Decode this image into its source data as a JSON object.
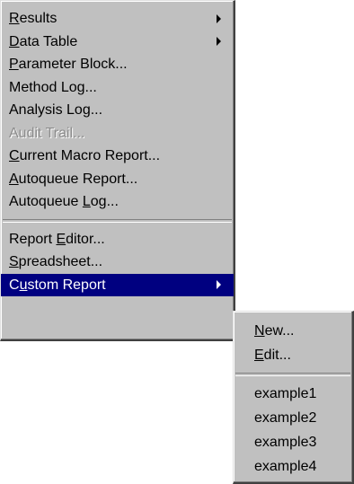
{
  "main_menu": {
    "items": [
      {
        "before": "",
        "accel": "R",
        "after": "esults",
        "submenu": true,
        "enabled": true
      },
      {
        "before": "",
        "accel": "D",
        "after": "ata Table",
        "submenu": true,
        "enabled": true
      },
      {
        "before": "",
        "accel": "P",
        "after": "arameter Block...",
        "submenu": false,
        "enabled": true
      },
      {
        "before": "Method Log...",
        "accel": "",
        "after": "",
        "submenu": false,
        "enabled": true
      },
      {
        "before": "Analysis Log...",
        "accel": "",
        "after": "",
        "submenu": false,
        "enabled": true
      },
      {
        "before": "Audit Trail...",
        "accel": "",
        "after": "",
        "submenu": false,
        "enabled": false
      },
      {
        "before": "",
        "accel": "C",
        "after": "urrent Macro Report...",
        "submenu": false,
        "enabled": true
      },
      {
        "before": "",
        "accel": "A",
        "after": "utoqueue Report...",
        "submenu": false,
        "enabled": true
      },
      {
        "before": "Autoqueue ",
        "accel": "L",
        "after": "og...",
        "submenu": false,
        "enabled": true
      },
      {
        "before": "Report ",
        "accel": "E",
        "after": "ditor...",
        "submenu": false,
        "enabled": true
      },
      {
        "before": "",
        "accel": "S",
        "after": "preadsheet...",
        "submenu": false,
        "enabled": true
      },
      {
        "before": "C",
        "accel": "u",
        "after": "stom Report",
        "submenu": true,
        "enabled": true,
        "selected": true
      }
    ]
  },
  "sub_menu": {
    "items": [
      {
        "before": "",
        "accel": "N",
        "after": "ew..."
      },
      {
        "before": "",
        "accel": "E",
        "after": "dit..."
      },
      {
        "before": "example1",
        "accel": "",
        "after": ""
      },
      {
        "before": "example2",
        "accel": "",
        "after": ""
      },
      {
        "before": "example3",
        "accel": "",
        "after": ""
      },
      {
        "before": "example4",
        "accel": "",
        "after": ""
      }
    ]
  },
  "colors": {
    "menu_bg": "#c0c0c0",
    "highlight": "#000080",
    "disabled_text": "#8c8c8c"
  }
}
